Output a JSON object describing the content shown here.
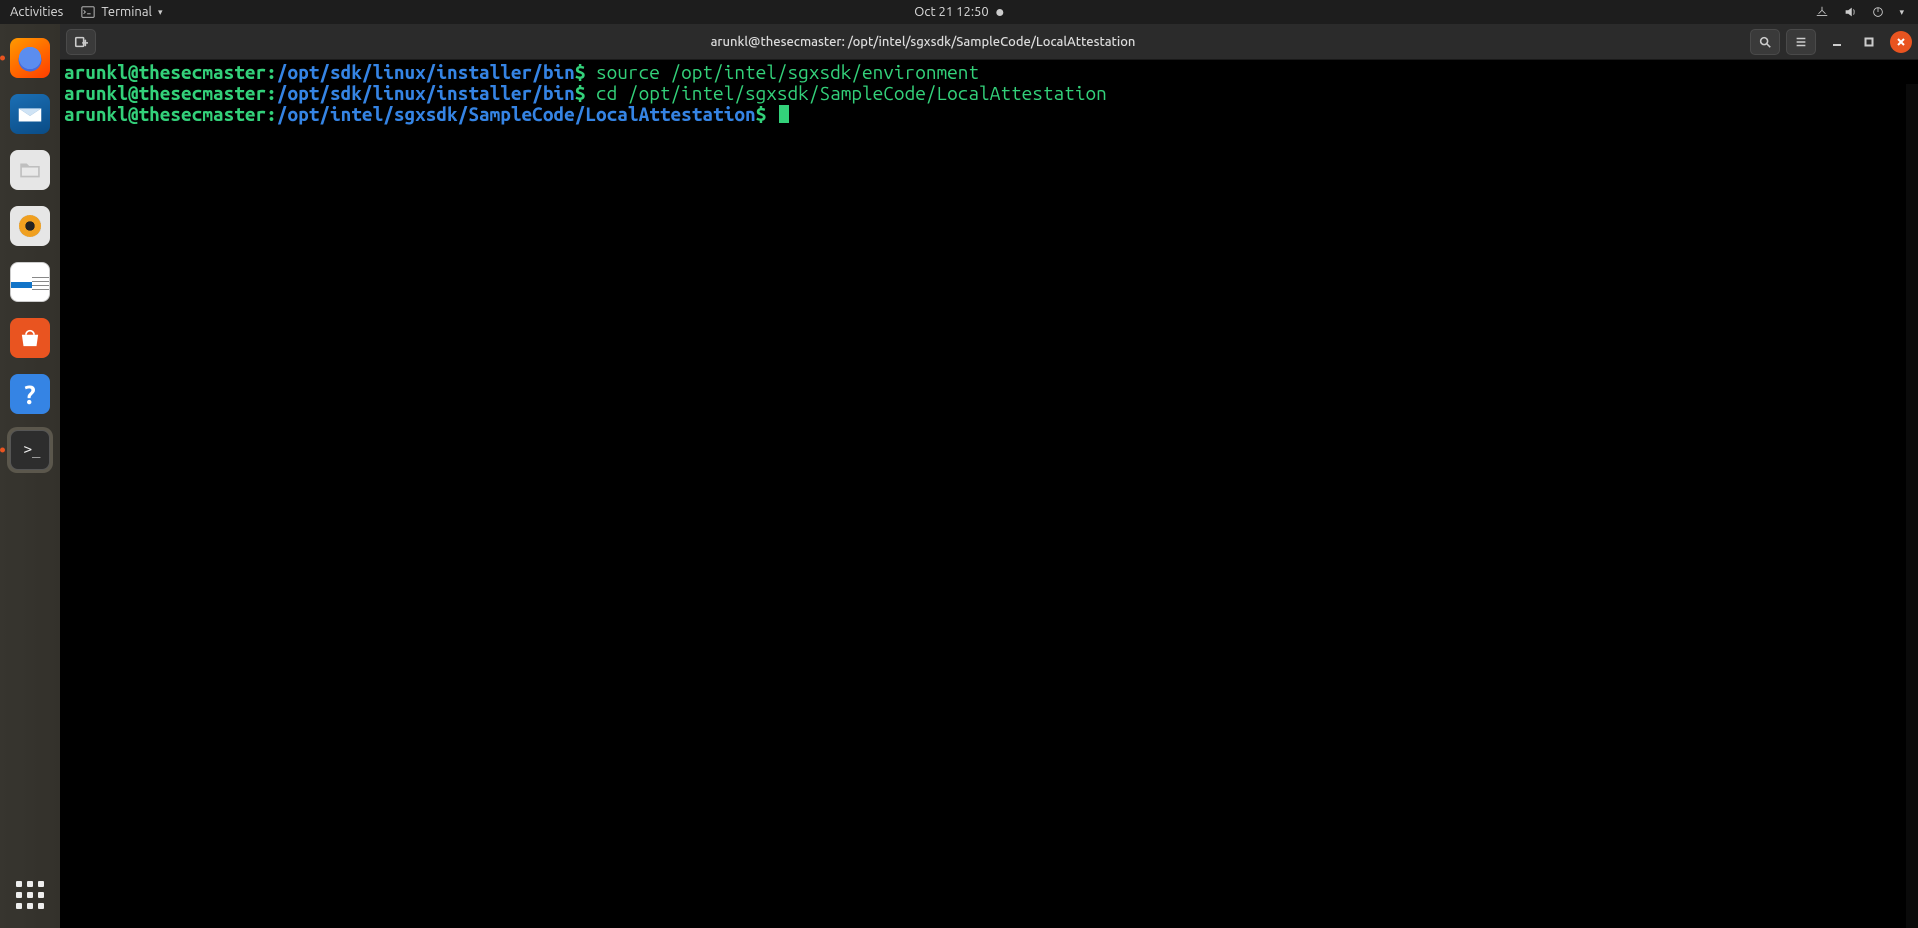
{
  "panel": {
    "activities": "Activities",
    "app_name": "Terminal",
    "clock": "Oct 21  12:50"
  },
  "dock": {
    "items": [
      {
        "name": "firefox",
        "running": true
      },
      {
        "name": "thunderbird",
        "running": false
      },
      {
        "name": "files",
        "running": false
      },
      {
        "name": "rhythmbox",
        "running": false
      },
      {
        "name": "libreoffice-writer",
        "running": false
      },
      {
        "name": "ubuntu-software",
        "running": false
      },
      {
        "name": "help",
        "running": false
      },
      {
        "name": "terminal",
        "running": true,
        "active": true
      }
    ]
  },
  "window": {
    "title": "arunkl@thesecmaster: /opt/intel/sgxsdk/SampleCode/LocalAttestation"
  },
  "terminal": {
    "lines": [
      {
        "user": "arunkl@thesecmaster",
        "path": "/opt/sdk/linux/installer/bin",
        "cmd": "source /opt/intel/sgxsdk/environment"
      },
      {
        "user": "arunkl@thesecmaster",
        "path": "/opt/sdk/linux/installer/bin",
        "cmd": "cd /opt/intel/sgxsdk/SampleCode/LocalAttestation"
      },
      {
        "user": "arunkl@thesecmaster",
        "path": "/opt/intel/sgxsdk/SampleCode/LocalAttestation",
        "cmd": "",
        "cursor": true
      }
    ]
  }
}
